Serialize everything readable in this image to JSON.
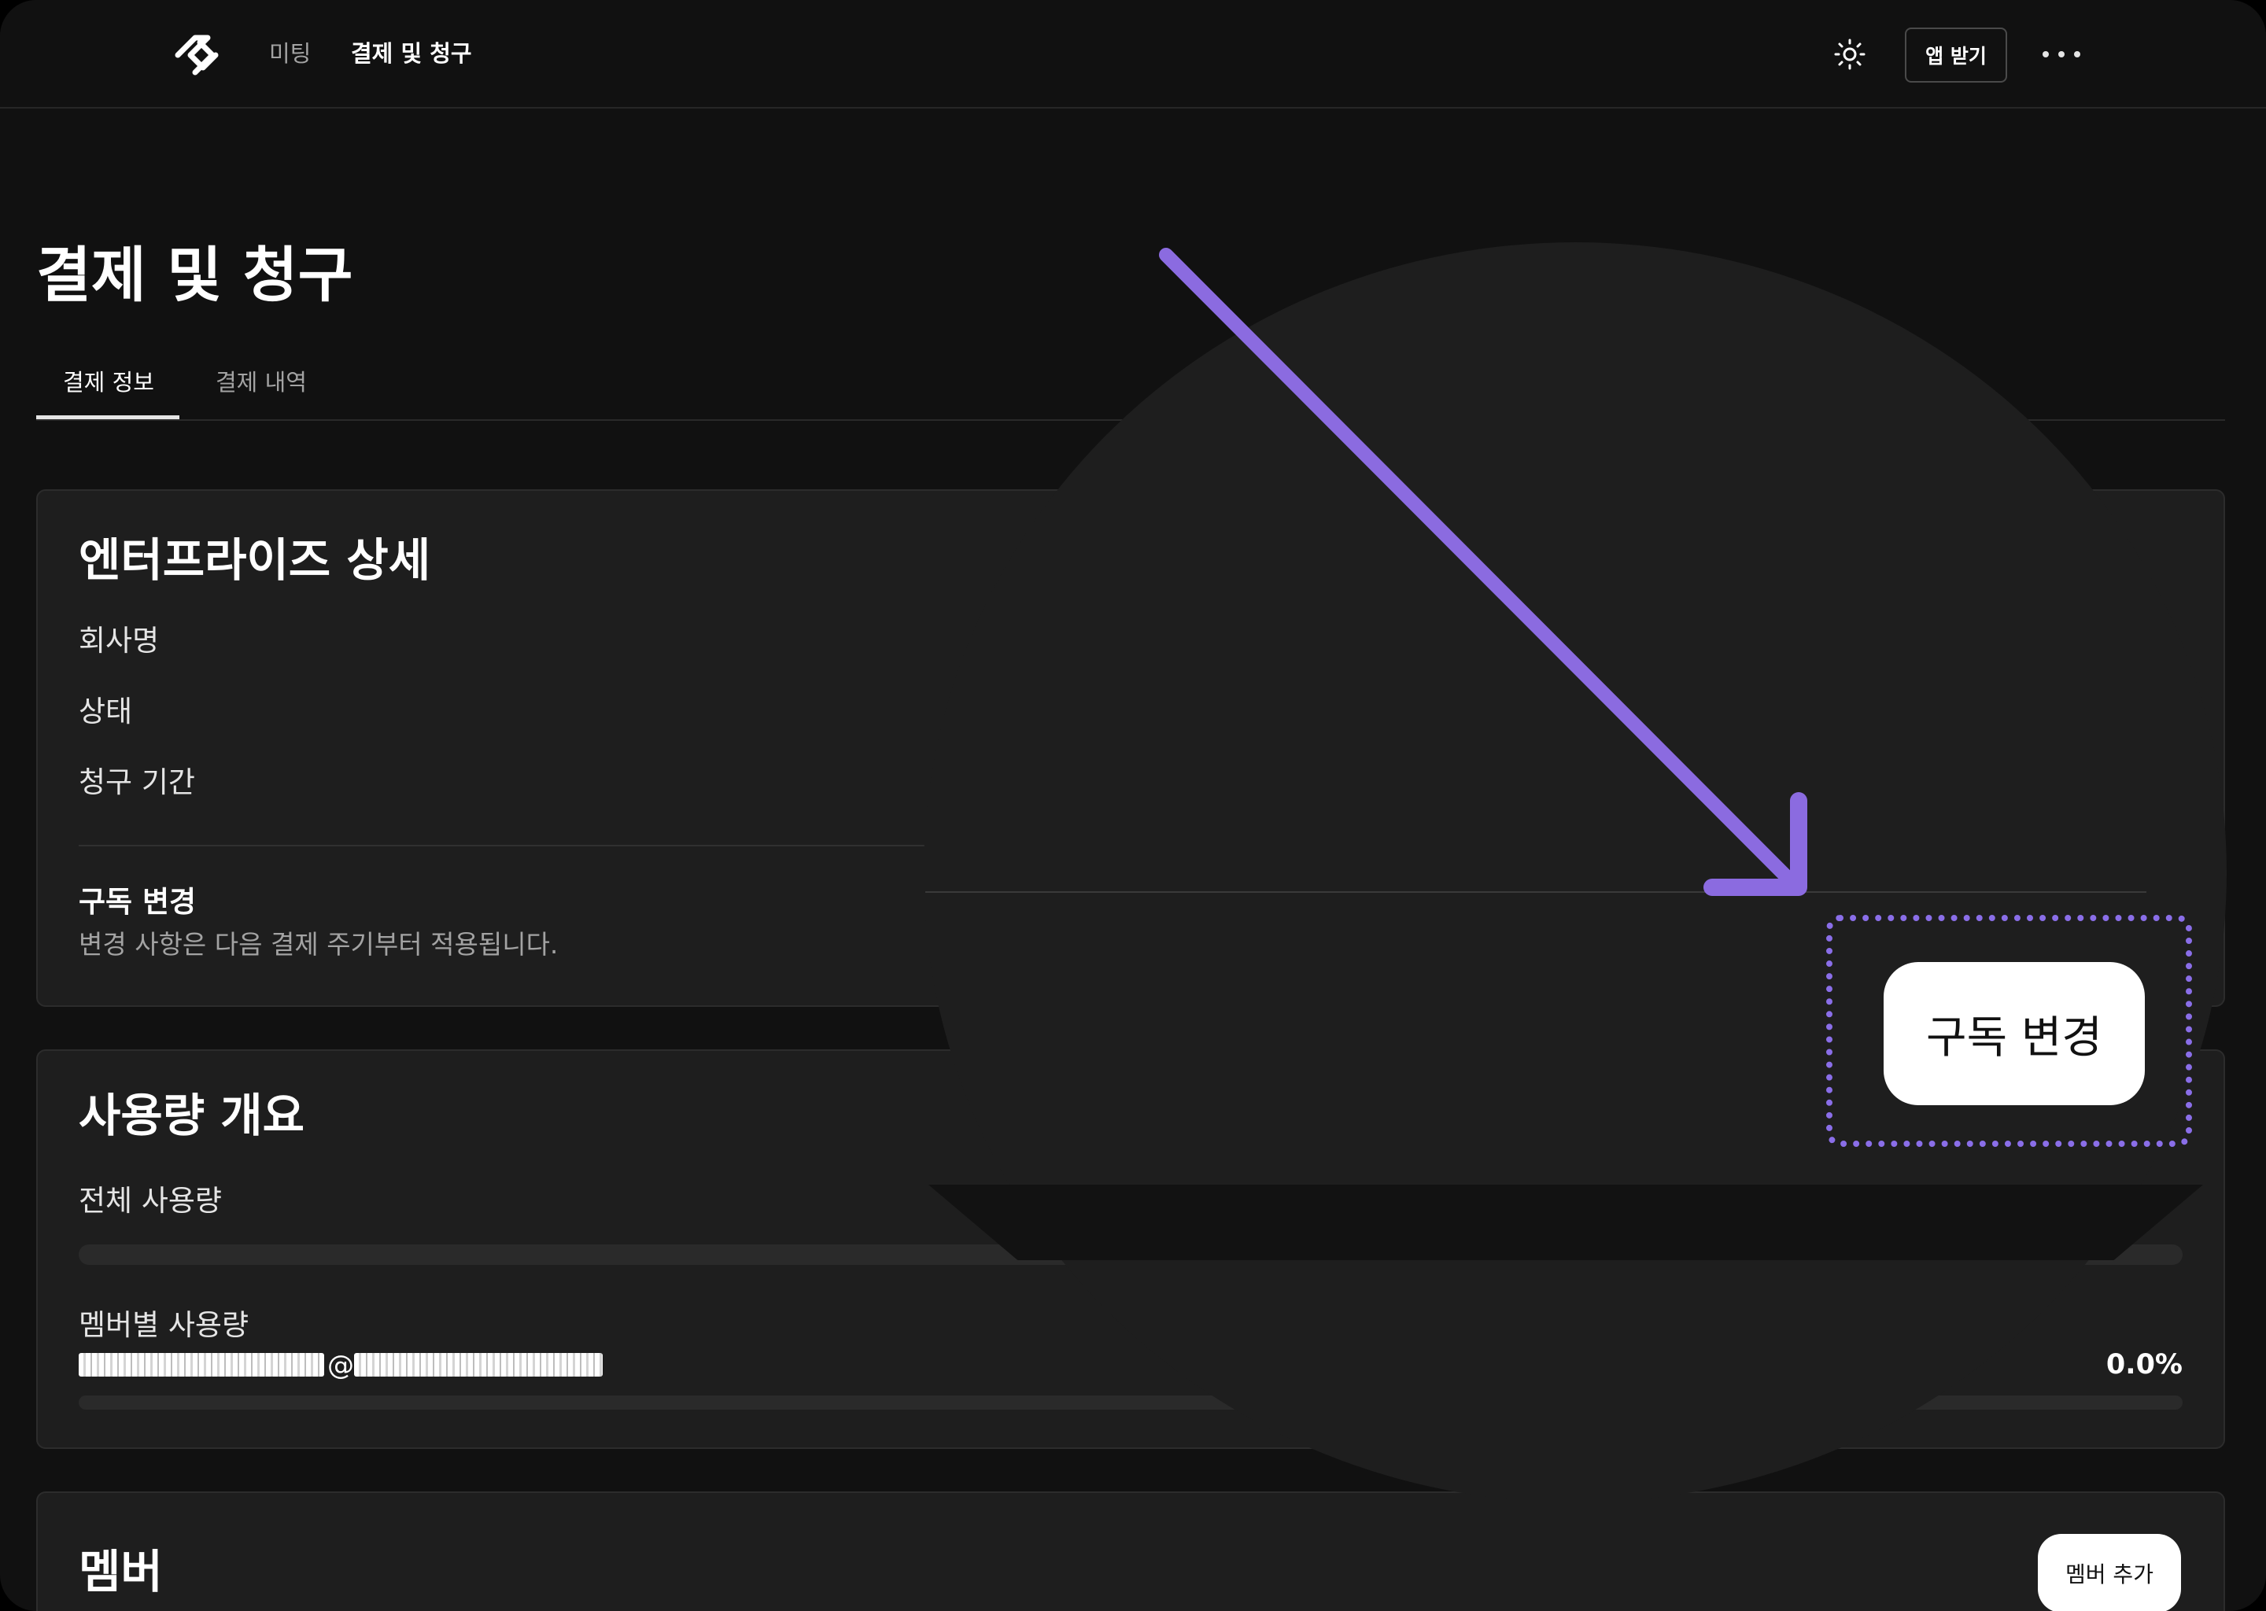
{
  "nav": {
    "links": [
      "미팅",
      "결제 및 청구"
    ],
    "app_button": "앱 받기"
  },
  "page": {
    "title": "결제 및 청구",
    "tabs": [
      "결제 정보",
      "결제 내역"
    ]
  },
  "enterprise": {
    "title": "엔터프라이즈 상세",
    "fields": [
      "회사명",
      "상태",
      "청구 기간"
    ],
    "subscription_title": "구독 변경",
    "subscription_desc": "변경 사항은 다음 결제 주기부터 적용됩니다.",
    "change_button": "구독 변경"
  },
  "usage": {
    "title": "사용량 개요",
    "total_label": "전체 사용량",
    "member_label": "멤버별 사용량",
    "member_email_at": "@",
    "member_percent": "0.0%",
    "member_progress": 0.0
  },
  "members": {
    "title": "멤버",
    "add_button": "멤버 추가"
  },
  "colors": {
    "background": "#111111",
    "card": "#1e1e1e",
    "highlight": "#8a6ee8",
    "arrow": "#8b6be0"
  },
  "icons": [
    "logo-icon",
    "sun-icon",
    "more-icon",
    "arrow-annotation"
  ]
}
